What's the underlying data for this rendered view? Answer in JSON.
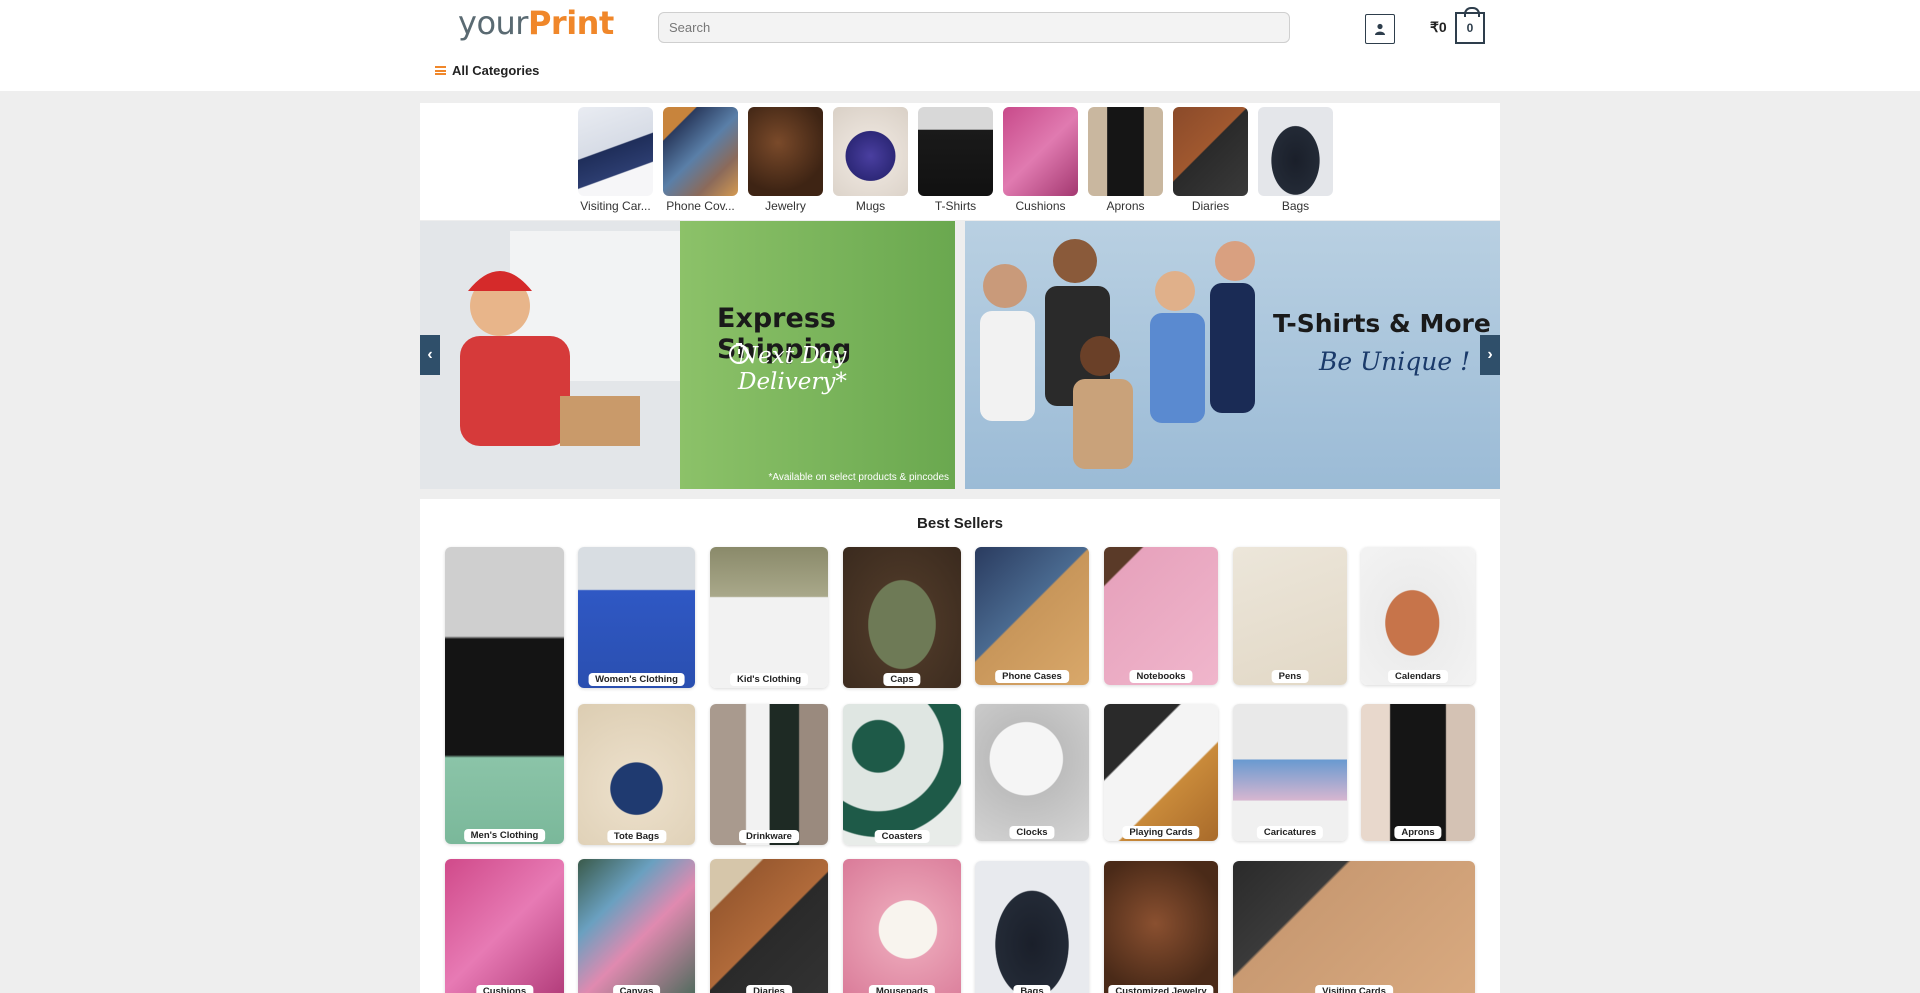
{
  "header": {
    "logo_part1": "your",
    "logo_part2": "Print",
    "search_placeholder": "Search",
    "price": "₹0",
    "cart_count": "0",
    "all_categories": "All Categories"
  },
  "categories": [
    {
      "label": "Visiting Car..."
    },
    {
      "label": "Phone Cov..."
    },
    {
      "label": "Jewelry"
    },
    {
      "label": "Mugs"
    },
    {
      "label": "T-Shirts"
    },
    {
      "label": "Cushions"
    },
    {
      "label": "Aprons"
    },
    {
      "label": "Diaries"
    },
    {
      "label": "Bags"
    }
  ],
  "banners": {
    "left": {
      "headline": "Express Shipping",
      "subline": "Next Day Delivery*",
      "footnote": "*Available on select products & pincodes"
    },
    "right": {
      "headline": "T-Shirts & More",
      "subline": "Be Unique !"
    }
  },
  "best_sellers": {
    "title": "Best Sellers",
    "items": [
      {
        "label": "Men's Clothing"
      },
      {
        "label": "Women's Clothing"
      },
      {
        "label": "Kid's Clothing"
      },
      {
        "label": "Caps"
      },
      {
        "label": "Phone Cases"
      },
      {
        "label": "Notebooks"
      },
      {
        "label": "Pens"
      },
      {
        "label": "Calendars"
      },
      {
        "label": "Tote Bags"
      },
      {
        "label": "Drinkware"
      },
      {
        "label": "Coasters"
      },
      {
        "label": "Clocks"
      },
      {
        "label": "Playing Cards"
      },
      {
        "label": "Caricatures"
      },
      {
        "label": "Aprons"
      },
      {
        "label": "Cushions"
      },
      {
        "label": "Canvas"
      },
      {
        "label": "Diaries"
      },
      {
        "label": "Mousepads"
      },
      {
        "label": "Bags"
      },
      {
        "label": "Customized Jewelry"
      },
      {
        "label": "Visiting Cards"
      }
    ]
  },
  "colors": {
    "brand_orange": "#f0872a",
    "brand_grey": "#5a6a72",
    "nav_dark": "#2f4f6a"
  }
}
